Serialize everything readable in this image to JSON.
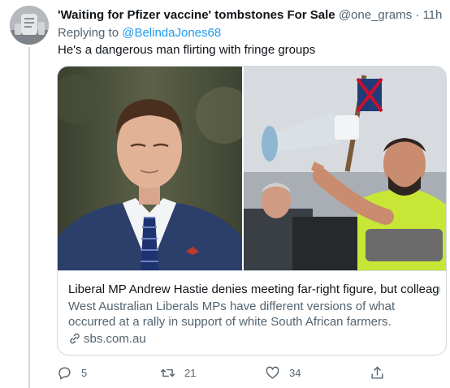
{
  "tweet": {
    "display_name": "'Waiting for Pfizer vaccine' tombstones For Sale",
    "handle": "@one_grams",
    "separator": "·",
    "time": "11h",
    "replying_to_label": "Replying to",
    "replying_to_handle": "@BelindaJones68",
    "text": "He's a dangerous man flirting with fringe groups"
  },
  "card": {
    "title": "Liberal MP Andrew Hastie denies meeting far-right figure, but colleagu...",
    "description": "West Australian Liberals MPs have different versions of what occurred at a rally in support of white South African farmers.",
    "domain": "sbs.com.au"
  },
  "actions": {
    "reply_count": "5",
    "retweet_count": "21",
    "like_count": "34"
  },
  "icons": [
    "avatar",
    "link-icon",
    "reply-icon",
    "retweet-icon",
    "like-icon",
    "share-icon"
  ],
  "colors": {
    "link_blue": "#1d9bf0",
    "secondary_text": "#536471",
    "border": "#cfd9de",
    "hi_vis_shirt": "#c8e636"
  }
}
